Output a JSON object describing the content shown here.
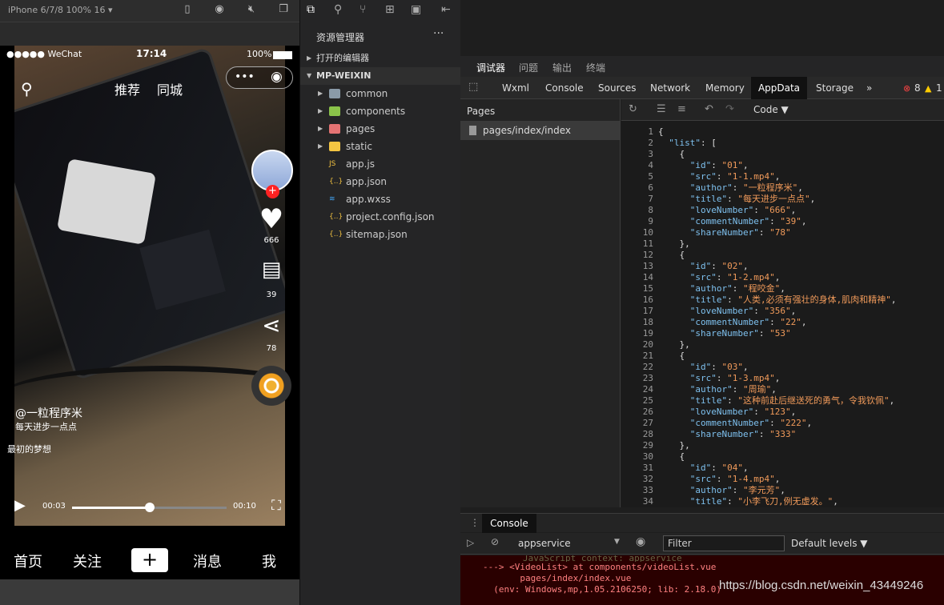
{
  "simulator": {
    "device": "iPhone 6/7/8 100% 16 ▾",
    "status": {
      "carrier": "●●●●● WeChat",
      "time": "17:14",
      "battery": "100%"
    },
    "tabs": [
      "推荐",
      "同城"
    ],
    "side": {
      "likes": "666",
      "comments": "39",
      "shares": "78"
    },
    "author": "@一粒程序米",
    "title": "每天进步一点点",
    "music": "最初的梦想",
    "time_current": "00:03",
    "time_total": "00:10",
    "progress": 0.5,
    "bottom_nav": [
      "首页",
      "关注",
      "+",
      "消息",
      "我"
    ]
  },
  "explorer": {
    "title": "资源管理器",
    "more": "···",
    "open_editors": "打开的编辑器",
    "project": "MP-WEIXIN",
    "items": [
      {
        "label": "common",
        "type": "folder",
        "color": "#8a9aa8"
      },
      {
        "label": "components",
        "type": "folder",
        "color": "#8bc34a"
      },
      {
        "label": "pages",
        "type": "folder",
        "color": "#e57373"
      },
      {
        "label": "static",
        "type": "folder",
        "color": "#f4c542"
      },
      {
        "label": "app.js",
        "type": "file",
        "color": "#f0c040",
        "icon": "JS"
      },
      {
        "label": "app.json",
        "type": "file",
        "color": "#f0c040",
        "icon": "{..}"
      },
      {
        "label": "app.wxss",
        "type": "file",
        "color": "#42a5f5",
        "icon": "≋"
      },
      {
        "label": "project.config.json",
        "type": "file",
        "color": "#f0c040",
        "icon": "{..}"
      },
      {
        "label": "sitemap.json",
        "type": "file",
        "color": "#f0c040",
        "icon": "{..}"
      }
    ]
  },
  "devtools": {
    "top_tabs": [
      "调试器",
      "问题",
      "输出",
      "终端"
    ],
    "panel_tabs": [
      "Wxml",
      "Console",
      "Sources",
      "Network",
      "Memory",
      "AppData",
      "Storage"
    ],
    "errors": "8",
    "warnings": "1",
    "pages_header": "Pages",
    "page_item": "pages/index/index",
    "code_mode": "Code ▼",
    "code_lines": [
      "{",
      "  \"list\": [",
      "    {",
      "      \"id\": \"01\",",
      "      \"src\": \"1-1.mp4\",",
      "      \"author\": \"一粒程序米\",",
      "      \"title\": \"每天进步一点点\",",
      "      \"loveNumber\": \"666\",",
      "      \"commentNumber\": \"39\",",
      "      \"shareNumber\": \"78\"",
      "    },",
      "    {",
      "      \"id\": \"02\",",
      "      \"src\": \"1-2.mp4\",",
      "      \"author\": \"程咬金\",",
      "      \"title\": \"人类,必须有强壮的身体,肌肉和精神\",",
      "      \"loveNumber\": \"356\",",
      "      \"commentNumber\": \"22\",",
      "      \"shareNumber\": \"53\"",
      "    },",
      "    {",
      "      \"id\": \"03\",",
      "      \"src\": \"1-3.mp4\",",
      "      \"author\": \"周瑜\",",
      "      \"title\": \"这种前赴后继送死的勇气，令我钦佩\",",
      "      \"loveNumber\": \"123\",",
      "      \"commentNumber\": \"222\",",
      "      \"shareNumber\": \"333\"",
      "    },",
      "    {",
      "      \"id\": \"04\",",
      "      \"src\": \"1-4.mp4\",",
      "      \"author\": \"李元芳\",",
      "      \"title\": \"小李飞刀,例无虚发。\","
    ],
    "console_tab": "Console",
    "context": "appservice",
    "filter": "Filter",
    "levels": "Default levels ▼",
    "error_lines": [
      "JavaScript context: appservice",
      "---> <VideoList> at components/videoList.vue",
      "       pages/index/index.vue",
      "  (env: Windows,mp,1.05.2106250; lib: 2.18.0)"
    ],
    "watermark": "https://blog.csdn.net/weixin_43449246"
  }
}
